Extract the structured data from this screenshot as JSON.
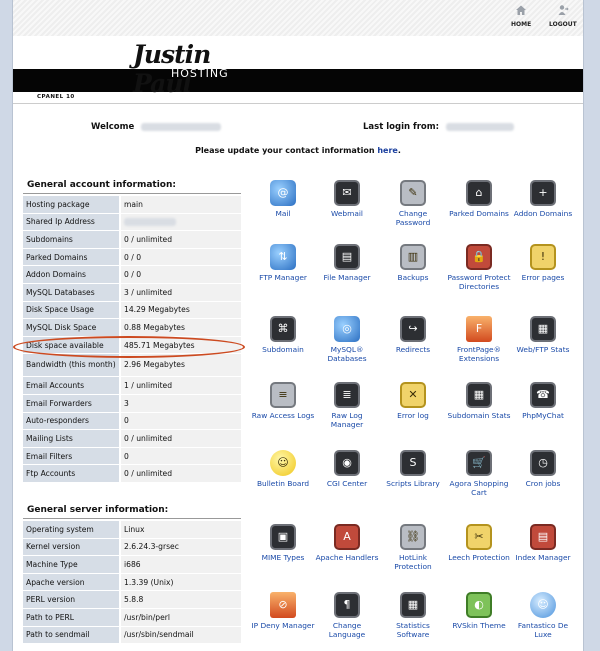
{
  "topnav": {
    "home": "HOME",
    "logout": "LOGOUT"
  },
  "brand": {
    "name": "Justin Paul",
    "sub": "HOSTING"
  },
  "cpanel_label": "CPANEL 10",
  "welcome": {
    "label": "Welcome",
    "last_login_label": "Last login from:"
  },
  "update_notice": {
    "text": "Please update your contact information",
    "link": "here",
    "suffix": "."
  },
  "general_account": {
    "title": "General account information:",
    "rows": [
      {
        "k": "Hosting package",
        "v": "main"
      },
      {
        "k": "Shared Ip Address",
        "v": ""
      },
      {
        "k": "Subdomains",
        "v": "0 / unlimited"
      },
      {
        "k": "Parked Domains",
        "v": "0 / 0"
      },
      {
        "k": "Addon Domains",
        "v": "0 / 0"
      },
      {
        "k": "MySQL Databases",
        "v": "3 / unlimited"
      },
      {
        "k": "Disk Space Usage",
        "v": "14.29 Megabytes"
      },
      {
        "k": "MySQL Disk Space",
        "v": "0.88 Megabytes"
      },
      {
        "k": "Disk space available",
        "v": "485.71 Megabytes"
      },
      {
        "k": "Bandwidth (this month)",
        "v": "2.96 Megabytes"
      },
      {
        "k": "Email Accounts",
        "v": "1 / unlimited"
      },
      {
        "k": "Email Forwarders",
        "v": "3"
      },
      {
        "k": "Auto-responders",
        "v": "0"
      },
      {
        "k": "Mailing Lists",
        "v": "0 / unlimited"
      },
      {
        "k": "Email Filters",
        "v": "0"
      },
      {
        "k": "Ftp Accounts",
        "v": "0 / unlimited"
      }
    ]
  },
  "general_server": {
    "title": "General server information:",
    "rows": [
      {
        "k": "Operating system",
        "v": "Linux"
      },
      {
        "k": "Kernel version",
        "v": "2.6.24.3-grsec"
      },
      {
        "k": "Machine Type",
        "v": "i686"
      },
      {
        "k": "Apache version",
        "v": "1.3.39 (Unix)"
      },
      {
        "k": "PERL version",
        "v": "5.8.8"
      },
      {
        "k": "Path to PERL",
        "v": "/usr/bin/perl"
      },
      {
        "k": "Path to sendmail",
        "v": "/usr/sbin/sendmail"
      }
    ]
  },
  "tools": [
    {
      "label": "Mail",
      "icon": "mail-icon"
    },
    {
      "label": "Webmail",
      "icon": "webmail-icon"
    },
    {
      "label": "Change Password",
      "icon": "password-icon"
    },
    {
      "label": "Parked Domains",
      "icon": "parked-domains-icon"
    },
    {
      "label": "Addon Domains",
      "icon": "addon-domains-icon"
    },
    {
      "label": "FTP Manager",
      "icon": "ftp-icon"
    },
    {
      "label": "File Manager",
      "icon": "file-manager-icon"
    },
    {
      "label": "Backups",
      "icon": "backups-icon"
    },
    {
      "label": "Password Protect Directories",
      "icon": "lock-folder-icon"
    },
    {
      "label": "Error pages",
      "icon": "error-pages-icon"
    },
    {
      "label": "Subdomain",
      "icon": "subdomain-icon"
    },
    {
      "label": "MySQL® Databases",
      "icon": "mysql-icon"
    },
    {
      "label": "Redirects",
      "icon": "redirects-icon"
    },
    {
      "label": "FrontPage® Extensions",
      "icon": "frontpage-icon"
    },
    {
      "label": "Web/FTP Stats",
      "icon": "stats-icon"
    },
    {
      "label": "Raw Access Logs",
      "icon": "raw-logs-icon"
    },
    {
      "label": "Raw Log Manager",
      "icon": "raw-log-manager-icon"
    },
    {
      "label": "Error log",
      "icon": "error-log-icon"
    },
    {
      "label": "Subdomain Stats",
      "icon": "subdomain-stats-icon"
    },
    {
      "label": "PhpMyChat",
      "icon": "chat-icon"
    },
    {
      "label": "Bulletin Board",
      "icon": "bulletin-board-icon"
    },
    {
      "label": "CGI Center",
      "icon": "cgi-icon"
    },
    {
      "label": "Scripts Library",
      "icon": "scripts-icon"
    },
    {
      "label": "Agora Shopping Cart",
      "icon": "shopping-cart-icon"
    },
    {
      "label": "Cron jobs",
      "icon": "cron-icon"
    },
    {
      "label": "MIME Types",
      "icon": "mime-icon"
    },
    {
      "label": "Apache Handlers",
      "icon": "apache-icon"
    },
    {
      "label": "HotLink Protection",
      "icon": "hotlink-icon"
    },
    {
      "label": "Leech Protection",
      "icon": "leech-icon"
    },
    {
      "label": "Index Manager",
      "icon": "index-icon"
    },
    {
      "label": "IP Deny Manager",
      "icon": "ip-deny-icon"
    },
    {
      "label": "Change Language",
      "icon": "language-icon"
    },
    {
      "label": "Statistics Software",
      "icon": "statistics-icon"
    },
    {
      "label": "RVSkin Theme",
      "icon": "theme-icon"
    },
    {
      "label": "Fantastico De Luxe",
      "icon": "fantastico-icon"
    }
  ]
}
